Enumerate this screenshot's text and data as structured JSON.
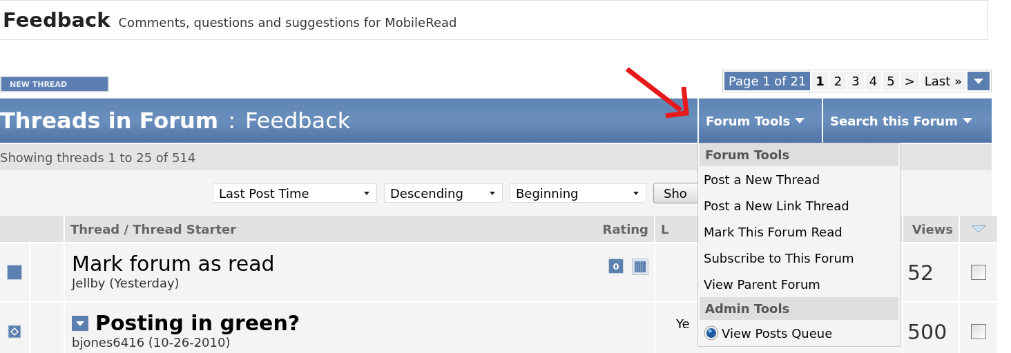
{
  "header": {
    "title": "Feedback",
    "description": "Comments, questions and suggestions for MobileRead"
  },
  "new_thread_button": "NEW THREAD",
  "pagination": {
    "label": "Page 1 of 21",
    "pages": [
      {
        "label": "1",
        "selected": true
      },
      {
        "label": "2",
        "selected": false
      },
      {
        "label": "3",
        "selected": false
      },
      {
        "label": "4",
        "selected": false
      },
      {
        "label": "5",
        "selected": false
      }
    ],
    "next": ">",
    "last": "Last »"
  },
  "forum_bar": {
    "title": "Threads in Forum",
    "separator": ":",
    "forum": "Feedback",
    "tools": [
      "Forum Tools",
      "Search this Forum"
    ]
  },
  "showing": "Showing threads 1 to 25 of 514",
  "sort": {
    "selects": [
      "Last Post Time",
      "Descending",
      "Beginning"
    ],
    "button": "Sho"
  },
  "columns": [
    "Thread / Thread Starter",
    "Rating",
    "L",
    "Views"
  ],
  "threads": [
    {
      "kind": "normal",
      "title": "Mark forum as read",
      "starter": "Jellby (Yesterday)",
      "rating": "0",
      "views": "52",
      "checked": false
    },
    {
      "kind": "bold",
      "title": "Posting in green?",
      "starter": "bjones6416 (10-26-2010)",
      "last_post": "Ye",
      "views": "500",
      "checked": false
    }
  ],
  "menu": {
    "sections": [
      {
        "title": "Forum Tools",
        "items": [
          "Post a New Thread",
          "Post a New Link Thread",
          "Mark This Forum Read",
          "Subscribe to This Forum",
          "View Parent Forum"
        ]
      },
      {
        "title": "Admin Tools",
        "items": [
          "View Posts Queue"
        ]
      }
    ]
  }
}
